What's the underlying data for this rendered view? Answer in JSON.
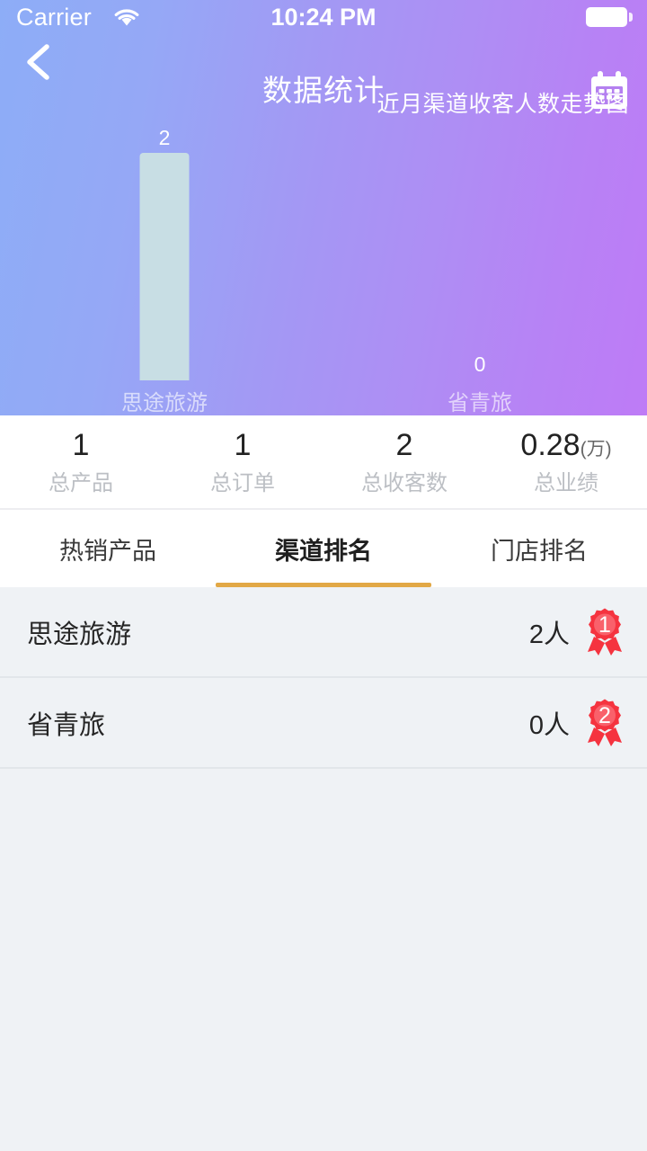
{
  "status_bar": {
    "carrier": "Carrier",
    "time": "10:24 PM",
    "wifi_icon": "wifi-icon",
    "battery_icon": "battery-icon"
  },
  "nav": {
    "back_icon": "chevron-left-icon",
    "title": "数据统计",
    "calendar_icon": "calendar-icon"
  },
  "chart_data": {
    "type": "bar",
    "title": "近月渠道收客人数走势图",
    "categories": [
      "思途旅游",
      "省青旅"
    ],
    "values": [
      2,
      0
    ],
    "value_labels": [
      "2",
      "0"
    ],
    "xlabel": "",
    "ylabel": "",
    "ylim": [
      0,
      2
    ],
    "grid": false,
    "legend": "none",
    "bar_color": "#C8DEE4",
    "label_color": "#FFFFFF"
  },
  "stats": [
    {
      "value": "1",
      "unit": "",
      "label": "总产品"
    },
    {
      "value": "1",
      "unit": "",
      "label": "总订单"
    },
    {
      "value": "2",
      "unit": "",
      "label": "总收客数"
    },
    {
      "value": "0.28",
      "unit": "(万)",
      "label": "总业绩"
    }
  ],
  "tabs": {
    "items": [
      {
        "label": "热销产品",
        "active": false
      },
      {
        "label": "渠道排名",
        "active": true
      },
      {
        "label": "门店排名",
        "active": false
      }
    ],
    "active_color": "#E2A846"
  },
  "ranking_list": [
    {
      "name": "思途旅游",
      "count": "2人",
      "rank": "1"
    },
    {
      "name": "省青旅",
      "count": "0人",
      "rank": "2"
    }
  ],
  "colors": {
    "gradient_start": "#8DADF7",
    "gradient_end": "#BE7BF6",
    "bar": "#C8DEE4",
    "accent": "#E2A846",
    "medal": "#F5333F",
    "page_bg": "#EFF2F5"
  }
}
